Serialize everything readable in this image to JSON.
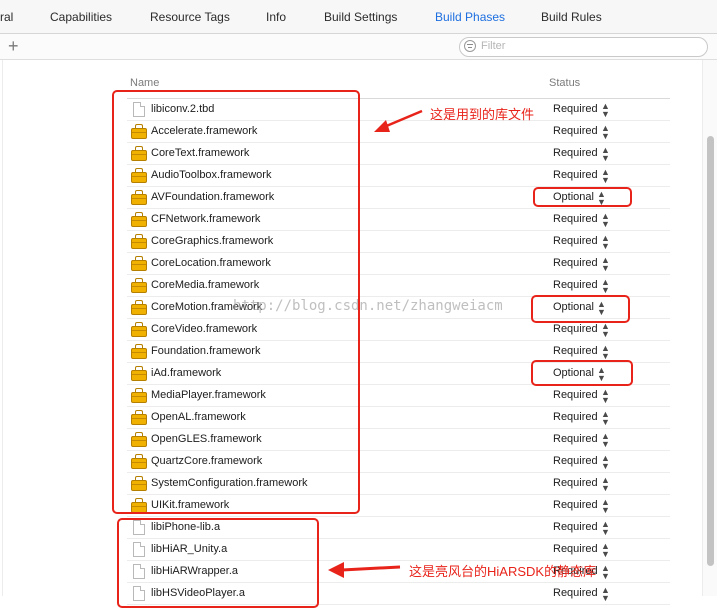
{
  "tabs": [
    {
      "label": "ral",
      "active": false
    },
    {
      "label": "Capabilities",
      "active": false
    },
    {
      "label": "Resource Tags",
      "active": false
    },
    {
      "label": "Info",
      "active": false
    },
    {
      "label": "Build Settings",
      "active": false
    },
    {
      "label": "Build Phases",
      "active": true
    },
    {
      "label": "Build Rules",
      "active": false
    }
  ],
  "toolbar": {
    "add_label": "+",
    "filter_placeholder": "Filter"
  },
  "table": {
    "columns": [
      "Name",
      "Status"
    ],
    "rows": [
      {
        "name": "libiconv.2.tbd",
        "status": "Required",
        "icon": "file-icon"
      },
      {
        "name": "Accelerate.framework",
        "status": "Required",
        "icon": "framework-icon"
      },
      {
        "name": "CoreText.framework",
        "status": "Required",
        "icon": "framework-icon"
      },
      {
        "name": "AudioToolbox.framework",
        "status": "Required",
        "icon": "framework-icon"
      },
      {
        "name": "AVFoundation.framework",
        "status": "Optional",
        "icon": "framework-icon"
      },
      {
        "name": "CFNetwork.framework",
        "status": "Required",
        "icon": "framework-icon"
      },
      {
        "name": "CoreGraphics.framework",
        "status": "Required",
        "icon": "framework-icon"
      },
      {
        "name": "CoreLocation.framework",
        "status": "Required",
        "icon": "framework-icon"
      },
      {
        "name": "CoreMedia.framework",
        "status": "Required",
        "icon": "framework-icon"
      },
      {
        "name": "CoreMotion.framework",
        "status": "Optional",
        "icon": "framework-icon"
      },
      {
        "name": "CoreVideo.framework",
        "status": "Required",
        "icon": "framework-icon"
      },
      {
        "name": "Foundation.framework",
        "status": "Required",
        "icon": "framework-icon"
      },
      {
        "name": "iAd.framework",
        "status": "Optional",
        "icon": "framework-icon"
      },
      {
        "name": "MediaPlayer.framework",
        "status": "Required",
        "icon": "framework-icon"
      },
      {
        "name": "OpenAL.framework",
        "status": "Required",
        "icon": "framework-icon"
      },
      {
        "name": "OpenGLES.framework",
        "status": "Required",
        "icon": "framework-icon"
      },
      {
        "name": "QuartzCore.framework",
        "status": "Required",
        "icon": "framework-icon"
      },
      {
        "name": "SystemConfiguration.framework",
        "status": "Required",
        "icon": "framework-icon"
      },
      {
        "name": "UIKit.framework",
        "status": "Required",
        "icon": "framework-icon"
      },
      {
        "name": "libiPhone-lib.a",
        "status": "Required",
        "icon": "file-icon"
      },
      {
        "name": "libHiAR_Unity.a",
        "status": "Required",
        "icon": "file-icon"
      },
      {
        "name": "libHiARWrapper.a",
        "status": "Required",
        "icon": "file-icon"
      },
      {
        "name": "libHSVideoPlayer.a",
        "status": "Required",
        "icon": "file-icon"
      }
    ]
  },
  "annotations": {
    "libraries": "这是用到的库文件",
    "static_libs": "这是亮风台的HiARSDK的静态库",
    "color": "#e8231a"
  },
  "watermark": "http://blog.csdn.net/zhangweiacm"
}
